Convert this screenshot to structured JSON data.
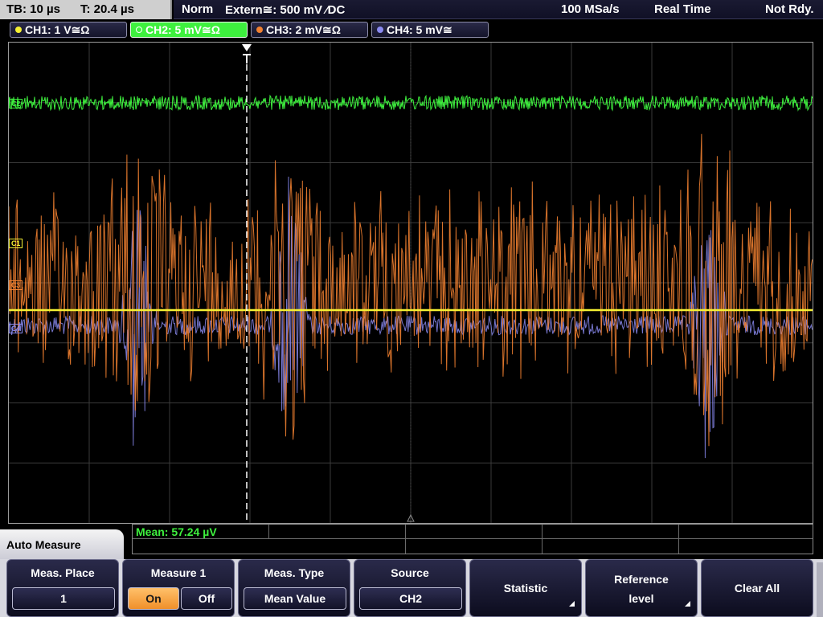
{
  "status": {
    "timebase": "TB: 10 µs",
    "trigger_time": "T: 20.4 µs",
    "trigger_mode": "Norm",
    "trigger_source": "Extern≅: 500 mV ⁄DC",
    "sample_rate": "100 MSa/s",
    "acquisition_mode": "Real Time",
    "run_state": "Not Rdy."
  },
  "channels": [
    {
      "label": "CH1: 1 V≅Ω",
      "color": "#f5f033",
      "active": false
    },
    {
      "label": "CH2: 5 mV≅Ω",
      "color": "#3ef03e",
      "active": true
    },
    {
      "label": "CH3: 2 mV≅Ω",
      "color": "#f08030",
      "active": false
    },
    {
      "label": "CH4: 5 mV≅",
      "color": "#8a8af0",
      "active": false
    }
  ],
  "markers": {
    "ch1": "C1",
    "ch2": "C2",
    "ch3": "C3",
    "ch4": "C4"
  },
  "measurement": {
    "readout": "Mean: 57.24 µV"
  },
  "menu": {
    "title": "Auto Measure",
    "meas_place_title": "Meas. Place",
    "meas_place_value": "1",
    "measure1_title": "Measure 1",
    "measure1_on": "On",
    "measure1_off": "Off",
    "measure1_state": "On",
    "meas_type_title": "Meas. Type",
    "meas_type_value": "Mean Value",
    "source_title": "Source",
    "source_value": "CH2",
    "statistic": "Statistic",
    "reference_level_1": "Reference",
    "reference_level_2": "level",
    "clear_all": "Clear All"
  },
  "colors": {
    "ch1": "#f5f033",
    "ch2": "#3ef03e",
    "ch3": "#f08030",
    "ch4": "#8a8af0",
    "grid": "#3a3a3a",
    "softkey_active": "#f0902a"
  }
}
